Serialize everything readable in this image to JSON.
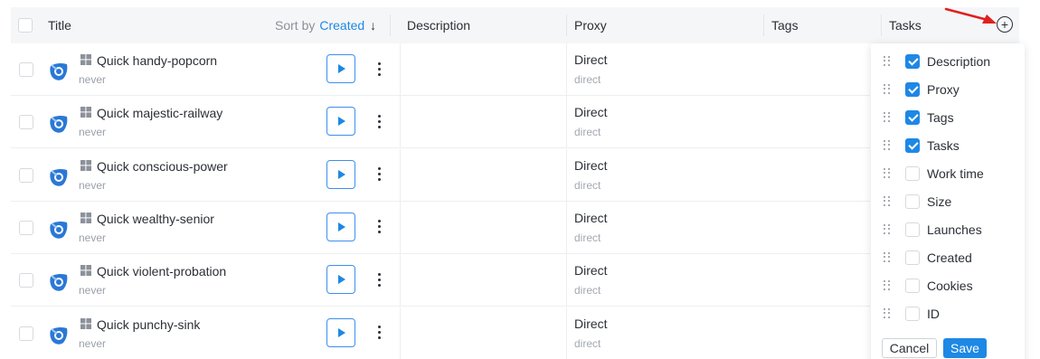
{
  "header": {
    "title_label": "Title",
    "sort_label": "Sort by",
    "sort_value": "Created",
    "sort_arrow": "↓",
    "description_label": "Description",
    "proxy_label": "Proxy",
    "tags_label": "Tags",
    "tasks_label": "Tasks",
    "add_column_icon": "plus-circle-icon"
  },
  "rows": [
    {
      "title": "Quick handy-popcorn",
      "last_run": "never",
      "proxy": "Direct",
      "proxy_type": "direct"
    },
    {
      "title": "Quick majestic-railway",
      "last_run": "never",
      "proxy": "Direct",
      "proxy_type": "direct"
    },
    {
      "title": "Quick conscious-power",
      "last_run": "never",
      "proxy": "Direct",
      "proxy_type": "direct"
    },
    {
      "title": "Quick wealthy-senior",
      "last_run": "never",
      "proxy": "Direct",
      "proxy_type": "direct"
    },
    {
      "title": "Quick violent-probation",
      "last_run": "never",
      "proxy": "Direct",
      "proxy_type": "direct"
    },
    {
      "title": "Quick punchy-sink",
      "last_run": "never",
      "proxy": "Direct",
      "proxy_type": "direct"
    }
  ],
  "column_panel": {
    "items": [
      {
        "label": "Description",
        "checked": true
      },
      {
        "label": "Proxy",
        "checked": true
      },
      {
        "label": "Tags",
        "checked": true
      },
      {
        "label": "Tasks",
        "checked": true
      },
      {
        "label": "Work time",
        "checked": false
      },
      {
        "label": "Size",
        "checked": false
      },
      {
        "label": "Launches",
        "checked": false
      },
      {
        "label": "Created",
        "checked": false
      },
      {
        "label": "Cookies",
        "checked": false
      },
      {
        "label": "ID",
        "checked": false
      }
    ],
    "cancel_label": "Cancel",
    "save_label": "Save"
  },
  "colors": {
    "accent": "#1e88e5",
    "annotation_arrow": "#e02020",
    "header_bg": "#f5f6f8"
  }
}
